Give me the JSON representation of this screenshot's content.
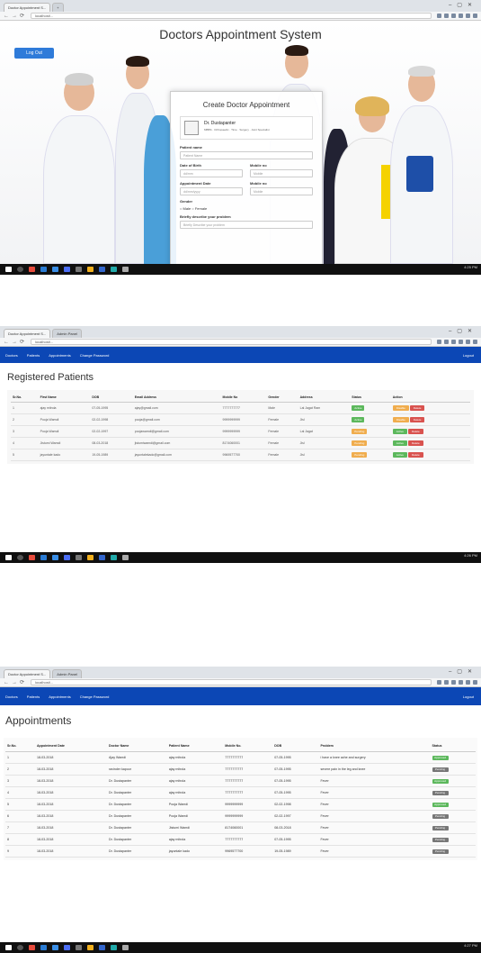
{
  "screen1": {
    "browser": {
      "tabs": [
        "Doctor Appointment S...",
        ""
      ],
      "url": "localhost/..."
    },
    "app_title": "Doctors Appointment System",
    "logout_label": "Log Out",
    "form": {
      "title": "Create Doctor Appointment",
      "doctor_name": "Dr. Dustapanter",
      "doctor_sub": "MBBS · Orthopaedic · Time · Surgery · Joint Specialist",
      "fields": {
        "patient_name": {
          "label": "Patient name",
          "placeholder": "Patient Name"
        },
        "date_of_birth": {
          "label": "Date of Birth",
          "placeholder": "dd/mm"
        },
        "mobile_no": {
          "label": "Mobile no",
          "placeholder": "Mobile"
        },
        "appointment_date": {
          "label": "Appointment Date",
          "placeholder": "dd/mm/yyyy"
        },
        "mobile_no2": {
          "label": "Mobile no",
          "placeholder": "Mobile"
        },
        "gender": {
          "label": "Gender",
          "options": "○ Male  ○ Female"
        },
        "problem": {
          "label": "Briefly describe your problem",
          "placeholder": "Briefly Describe your problem"
        }
      }
    },
    "taskbar_time": "4:25 PM"
  },
  "screen2": {
    "browser": {
      "tabs": [
        "Doctor Appointment S...",
        "Admin Panel"
      ],
      "url": "localhost/..."
    },
    "nav": [
      "Doctors",
      "Patients",
      "Appointments",
      "Change Password"
    ],
    "nav_logout": "Logout",
    "heading": "Registered Patients",
    "columns": [
      "Sr.No.",
      "First Name",
      "DOB",
      "Email Address",
      "Mobile No",
      "Gender",
      "Address",
      "Status",
      "Action"
    ],
    "rows": [
      {
        "no": "1",
        "name": "ajay mitrola",
        "dob": "07-05-1995",
        "email": "ajay@gmail.com",
        "mobile": "7777777777",
        "gender": "Male",
        "address": "Lal Jagat Ram",
        "status": "Active",
        "action": [
          "Disable",
          "Delete"
        ]
      },
      {
        "no": "2",
        "name": "Pooja Wamdi",
        "dob": "02-02-1998",
        "email": "pooja@gmail.com",
        "mobile": "9999999999",
        "gender": "Female",
        "address": "Jisl",
        "status": "Active",
        "action": [
          "Disable",
          "Delete"
        ]
      },
      {
        "no": "3",
        "name": "Pooja Wamdi",
        "dob": "02-02-1997",
        "email": "poojawamdi@gmail.com",
        "mobile": "9999999999",
        "gender": "Female",
        "address": "Lal Jagat",
        "status": "Pending",
        "action": [
          "Active",
          "Delete"
        ]
      },
      {
        "no": "4",
        "name": "Jistumi Wamdi",
        "dob": "08-03-2018",
        "email": "jistumiwamdi@gmail.com",
        "mobile": "8174060001",
        "gender": "Female",
        "address": "Jisl",
        "status": "Pending",
        "action": [
          "Active",
          "Delete"
        ]
      },
      {
        "no": "5",
        "name": "jayuntale kado",
        "dob": "19-05-1989",
        "email": "jayuntalekado@gmail.com",
        "mobile": "9969577700",
        "gender": "Female",
        "address": "Jisl",
        "status": "Pending",
        "action": [
          "Active",
          "Delete"
        ]
      }
    ],
    "taskbar_time": "4:26 PM"
  },
  "screen3": {
    "browser": {
      "tabs": [
        "Doctor Appointment S...",
        "Admin Panel"
      ],
      "url": "localhost/..."
    },
    "nav": [
      "Doctors",
      "Patients",
      "Appointments",
      "Change Password"
    ],
    "nav_logout": "Logout",
    "heading": "Appointments",
    "columns": [
      "Sr.No.",
      "Appointment Date",
      "Doctor Name",
      "Patient Name",
      "Mobile No.",
      "DOB",
      "Problem",
      "Status"
    ],
    "rows": [
      {
        "no": "1",
        "date": "18-03-2018",
        "doctor": "Ajay Wamdi",
        "patient": "ajay mitrola",
        "mobile": "7777777777",
        "dob": "07-05-1995",
        "problem": "i have a knee ache and surgery",
        "status": "Approved"
      },
      {
        "no": "2",
        "date": "18-03-2018",
        "doctor": "ravinder kapoor",
        "patient": "ajay mitrola",
        "mobile": "7777777777",
        "dob": "07-05-1995",
        "problem": "severe pain in the leg and knee",
        "status": "Pending"
      },
      {
        "no": "3",
        "date": "18-03-2018",
        "doctor": "Dr. Dustapanter",
        "patient": "ajay mitrola",
        "mobile": "7777777777",
        "dob": "07-05-1995",
        "problem": "Fever",
        "status": "Approved"
      },
      {
        "no": "4",
        "date": "18-03-2018",
        "doctor": "Dr. Dustapanter",
        "patient": "ajay mitrola",
        "mobile": "7777777777",
        "dob": "07-05-1995",
        "problem": "Fever",
        "status": "Pending"
      },
      {
        "no": "5",
        "date": "18-03-2018",
        "doctor": "Dr. Dustapanter",
        "patient": "Pooja Wamdi",
        "mobile": "9999999999",
        "dob": "02-02-1998",
        "problem": "Fever",
        "status": "Approved"
      },
      {
        "no": "6",
        "date": "18-03-2018",
        "doctor": "Dr. Dustapanter",
        "patient": "Pooja Wamdi",
        "mobile": "9999999999",
        "dob": "02-02-1997",
        "problem": "Fever",
        "status": "Pending"
      },
      {
        "no": "7",
        "date": "18-03-2018",
        "doctor": "Dr. Dustapanter",
        "patient": "Jistumi Wamdi",
        "mobile": "8174060001",
        "dob": "08-03-2018",
        "problem": "Fever",
        "status": "Pending"
      },
      {
        "no": "8",
        "date": "18-03-2018",
        "doctor": "Dr. Dustapanter",
        "patient": "ajay mitrola",
        "mobile": "7777777777",
        "dob": "07-05-1995",
        "problem": "Fever",
        "status": "Pending"
      },
      {
        "no": "9",
        "date": "18-03-2018",
        "doctor": "Dr. Dustapanter",
        "patient": "jayuntale kado",
        "mobile": "9969577700",
        "dob": "19-05-1989",
        "problem": "Fever",
        "status": "Pending"
      }
    ],
    "taskbar_time": "4:27 PM"
  },
  "colors": {
    "navbar": "#0c47b5",
    "active": "#5cb85c",
    "pending": "#f0ad4e",
    "delete": "#d9534f",
    "status_pending": "#777777"
  }
}
